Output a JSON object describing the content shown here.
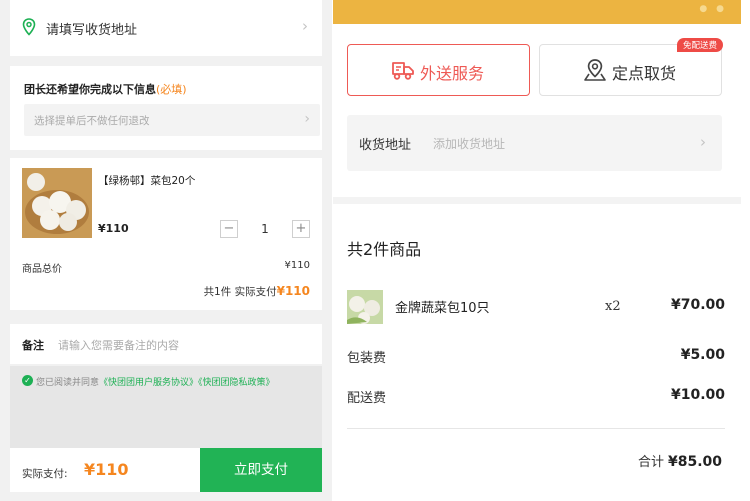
{
  "left": {
    "address_prompt": "请填写收货地址",
    "info_title": "团长还希望你完成以下信息",
    "info_required": "(必填)",
    "info_select_placeholder": "选择提单后不做任何退改",
    "product": {
      "name": "【绿杨邨】菜包20个",
      "price": "¥110",
      "quantity": "1",
      "minus": "−",
      "plus": "+",
      "total_label": "商品总价",
      "total_value": "¥110",
      "summary_prefix": "共1件  实际支付",
      "summary_amount": "¥110"
    },
    "note_label": "备注",
    "note_placeholder": "请输入您需要备注的内容",
    "agreement": {
      "prefix": "您已阅读并同意",
      "link1": "《快团团用户服务协议》",
      "link2": "《快团团隐私政策》"
    },
    "footer": {
      "pay_label": "实际支付:",
      "pay_amount": "¥110",
      "pay_button": "立即支付"
    }
  },
  "right": {
    "delivery_label": "外送服务",
    "pickup_label": "定点取货",
    "pickup_badge": "免配送费",
    "address_label": "收货地址",
    "address_placeholder": "添加收货地址",
    "item_count": "共2件商品",
    "item": {
      "name": "金牌蔬菜包10只",
      "qty": "x2",
      "price": "¥70.00"
    },
    "packing_label": "包装费",
    "packing_value": "¥5.00",
    "shipping_label": "配送费",
    "shipping_value": "¥10.00",
    "total_label": "合计",
    "total_value": "¥85.00"
  },
  "colors": {
    "green": "#21b355",
    "orange": "#f5861f",
    "red": "#ee5a55",
    "yellow_bar": "#ecb441"
  },
  "icons": [
    "location-pin-icon",
    "chevron-right-icon",
    "delivery-truck-icon",
    "map-pin-icon",
    "check-circle-icon"
  ]
}
